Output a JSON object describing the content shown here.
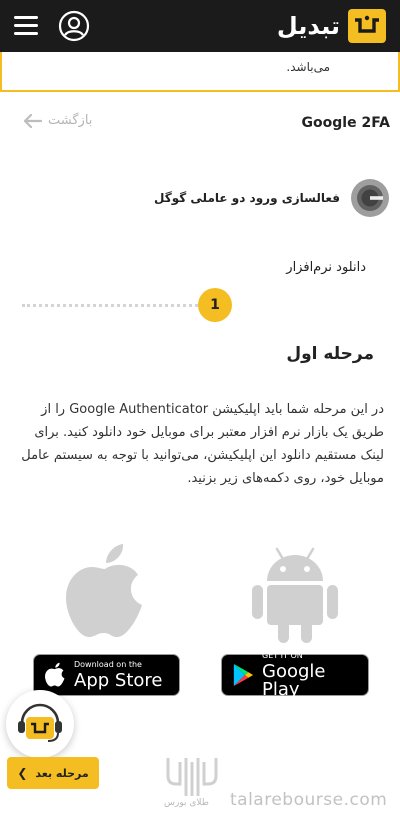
{
  "header": {
    "brand_name": "تبدیل",
    "menu_icon": "hamburger-menu-icon",
    "user_icon": "user-account-icon",
    "brand_color": "#f4bd21",
    "background": "#1b1b1b"
  },
  "notice": {
    "text": "می‌باشد."
  },
  "nav": {
    "page_title": "Google 2FA",
    "back_label": "بازگشت",
    "back_icon": "arrow-left-icon"
  },
  "gauth": {
    "label": "فعالسازی ورود دو عاملی گوگل",
    "icon": "google-authenticator-icon"
  },
  "steps": {
    "label": "دانلود نرم‌افزار",
    "current": "1"
  },
  "stage": {
    "title": "مرحله اول",
    "description": "در این مرحله شما باید اپلیکیشن Google Authenticator را از طریق یک بازار نرم افزار معتبر برای موبایل خود دانلود کنید. برای لینک مستقیم دانلود این اپلیکیشن، می‌توانید با توجه به سیستم عامل موبایل خود، روی دکمه‌های زیر بزنید."
  },
  "stores": {
    "appstore_small": "Download on the",
    "appstore_big": "App Store",
    "googleplay_small": "GET IT ON",
    "googleplay_big": "Google Play"
  },
  "actions": {
    "next_label": "مرحله بعد",
    "support_icon": "support-chat-icon"
  },
  "watermark": {
    "brand": "طلای بورس",
    "site": "talarebourse.com"
  }
}
